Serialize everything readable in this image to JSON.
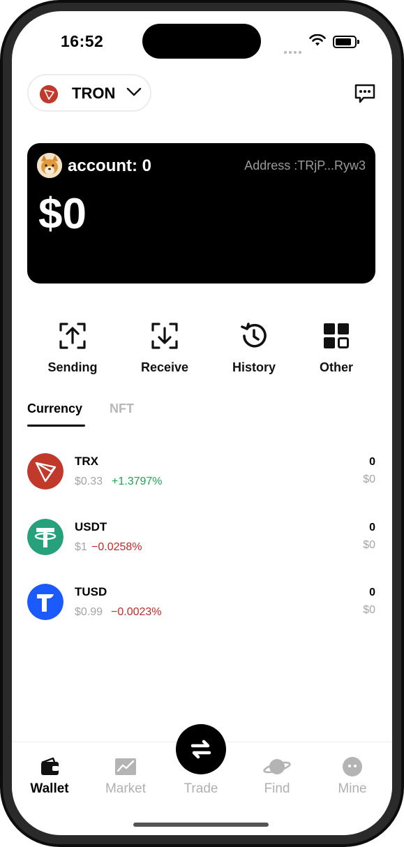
{
  "status_bar": {
    "time": "16:52"
  },
  "network": {
    "name": "TRON"
  },
  "account_card": {
    "account_label": "account: 0",
    "address": "Address :TRjP...Ryw3",
    "balance": "$0"
  },
  "actions": [
    {
      "label": "Sending",
      "icon": "upload-icon"
    },
    {
      "label": "Receive",
      "icon": "download-icon"
    },
    {
      "label": "History",
      "icon": "history-icon"
    },
    {
      "label": "Other",
      "icon": "grid-icon"
    }
  ],
  "tabs": [
    {
      "label": "Currency",
      "active": true
    },
    {
      "label": "NFT",
      "active": false
    }
  ],
  "tokens": [
    {
      "symbol": "TRX",
      "price": "$0.33",
      "change": "+1.3797%",
      "change_color": "#1ba755",
      "amount": "0",
      "value": "$0",
      "logo_color": "#c0392b"
    },
    {
      "symbol": "USDT",
      "price": "$1",
      "change": "−0.0258%",
      "change_color": "#c62828",
      "amount": "0",
      "value": "$0",
      "logo_color": "#26a17b"
    },
    {
      "symbol": "TUSD",
      "price": "$0.99",
      "change": "−0.0023%",
      "change_color": "#c62828",
      "amount": "0",
      "value": "$0",
      "logo_color": "#1a5aff"
    }
  ],
  "bottom_nav": [
    {
      "label": "Wallet",
      "active": true,
      "icon": "wallet-icon"
    },
    {
      "label": "Market",
      "active": false,
      "icon": "chart-icon"
    },
    {
      "label": "Trade",
      "active": false,
      "icon": "swap-icon"
    },
    {
      "label": "Find",
      "active": false,
      "icon": "planet-icon"
    },
    {
      "label": "Mine",
      "active": false,
      "icon": "profile-icon"
    }
  ]
}
